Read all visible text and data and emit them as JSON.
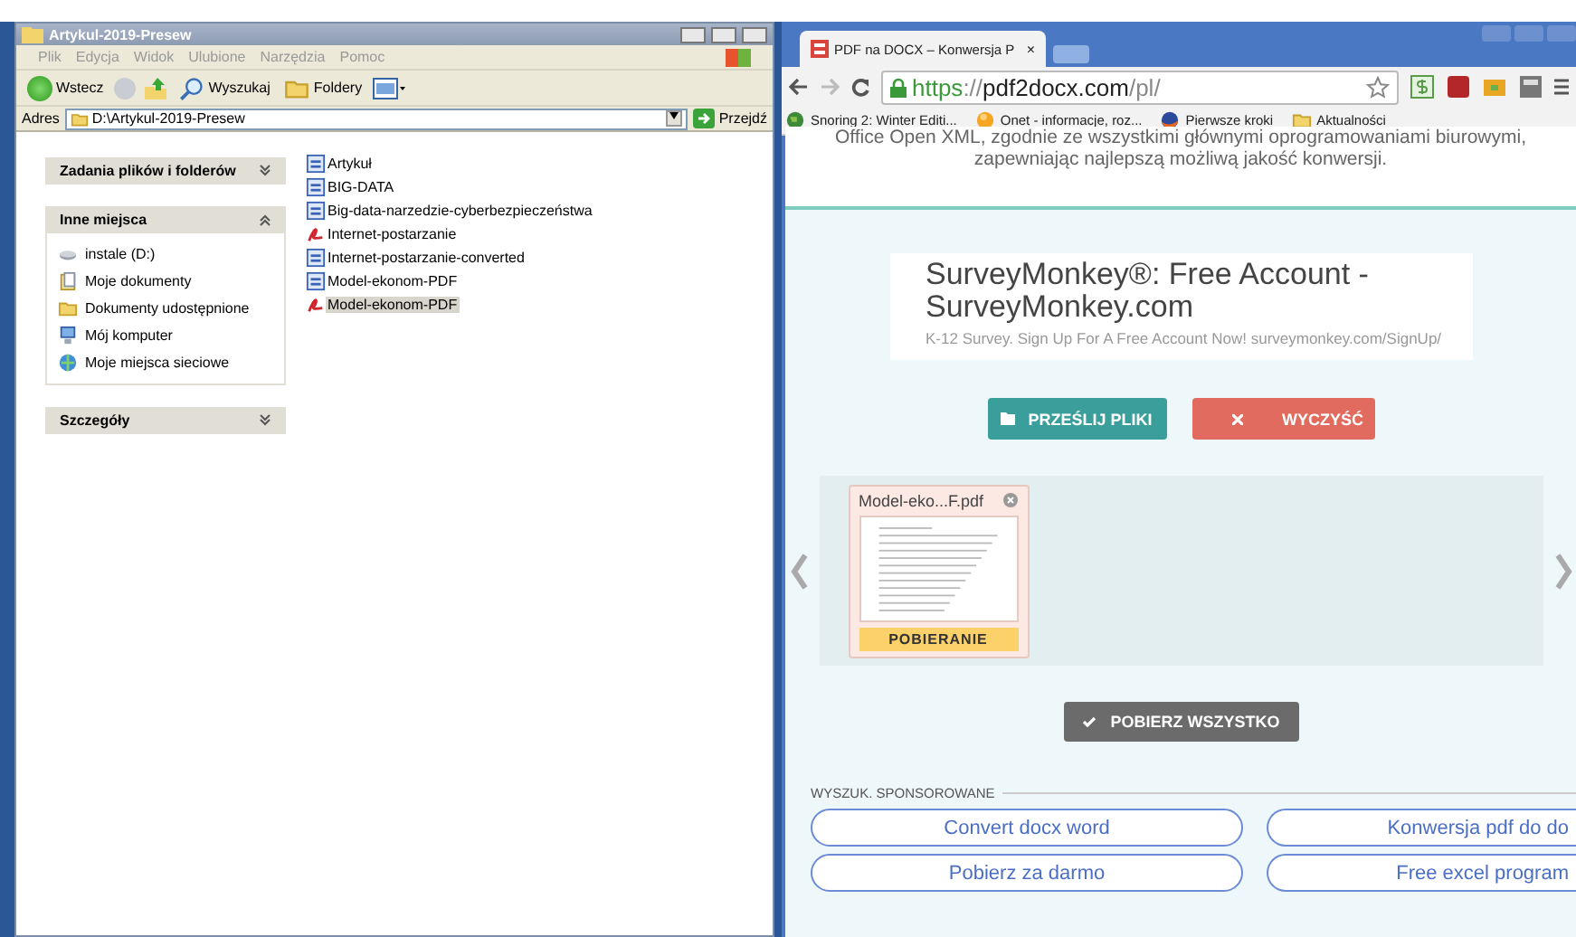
{
  "explorer": {
    "title": "Artykul-2019-Presew",
    "menu": [
      "Plik",
      "Edycja",
      "Widok",
      "Ulubione",
      "Narzędzia",
      "Pomoc"
    ],
    "toolbar": {
      "back": "Wstecz",
      "search": "Wyszukaj",
      "folders": "Foldery"
    },
    "address": {
      "label": "Adres",
      "path": "D:\\Artykul-2019-Presew",
      "go": "Przejdź"
    },
    "panels": [
      {
        "title": "Zadania plików i folderów",
        "expanded": false
      },
      {
        "title": "Inne miejsca",
        "expanded": true,
        "items": [
          {
            "label": "instale (D:)",
            "kind": "drive"
          },
          {
            "label": "Moje dokumenty",
            "kind": "documents"
          },
          {
            "label": "Dokumenty udostępnione",
            "kind": "folder"
          },
          {
            "label": "Mój komputer",
            "kind": "computer"
          },
          {
            "label": "Moje miejsca sieciowe",
            "kind": "network"
          }
        ]
      },
      {
        "title": "Szczegóły",
        "expanded": false
      }
    ],
    "files": [
      {
        "name": "Artykuł",
        "kind": "doc",
        "selected": false
      },
      {
        "name": "BIG-DATA",
        "kind": "doc",
        "selected": false
      },
      {
        "name": "Big-data-narzedzie-cyberbezpieczeństwa",
        "kind": "doc",
        "selected": false
      },
      {
        "name": "Internet-postarzanie",
        "kind": "pdf",
        "selected": false
      },
      {
        "name": "Internet-postarzanie-converted",
        "kind": "doc",
        "selected": false
      },
      {
        "name": "Model-ekonom-PDF",
        "kind": "doc",
        "selected": false
      },
      {
        "name": "Model-ekonom-PDF",
        "kind": "pdf",
        "selected": true
      }
    ]
  },
  "browser": {
    "tab": "PDF na DOCX – Konwersja P",
    "tab_close": "×",
    "url": {
      "scheme": "https",
      "rest": "://",
      "host": "pdf2docx.com",
      "path": "/pl/"
    },
    "bookmarks": [
      {
        "label": "Snoring 2: Winter Editi...",
        "kind": "globe"
      },
      {
        "label": "Onet - informacje, roz...",
        "kind": "ball"
      },
      {
        "label": "Pierwsze kroki",
        "kind": "fox"
      },
      {
        "label": "Aktualności",
        "kind": "folder"
      }
    ],
    "intro": "Office Open XML, zgodnie ze wszystkimi głównymi oprogramowaniami biurowymi, zapewniając najlepszą możliwą jakość konwersji.",
    "ad": {
      "title": "SurveyMonkey®: Free Account - SurveyMonkey.com",
      "description": "K-12 Survey. Sign Up For A Free Account Now! surveymonkey.com/SignUp/"
    },
    "upload": "PRZEŚLIJ PLIKI",
    "clear": "WYCZYŚĆ",
    "file_card": {
      "name": "Model-eko...F.pdf",
      "action": "POBIERANIE"
    },
    "download_all": "POBIERZ WSZYSTKO",
    "sponsored": {
      "heading": "WYSZUK. SPONSOROWANE",
      "links": [
        "Convert docx word",
        "Konwersja pdf do do",
        "Pobierz za darmo",
        "Free excel program"
      ]
    }
  }
}
